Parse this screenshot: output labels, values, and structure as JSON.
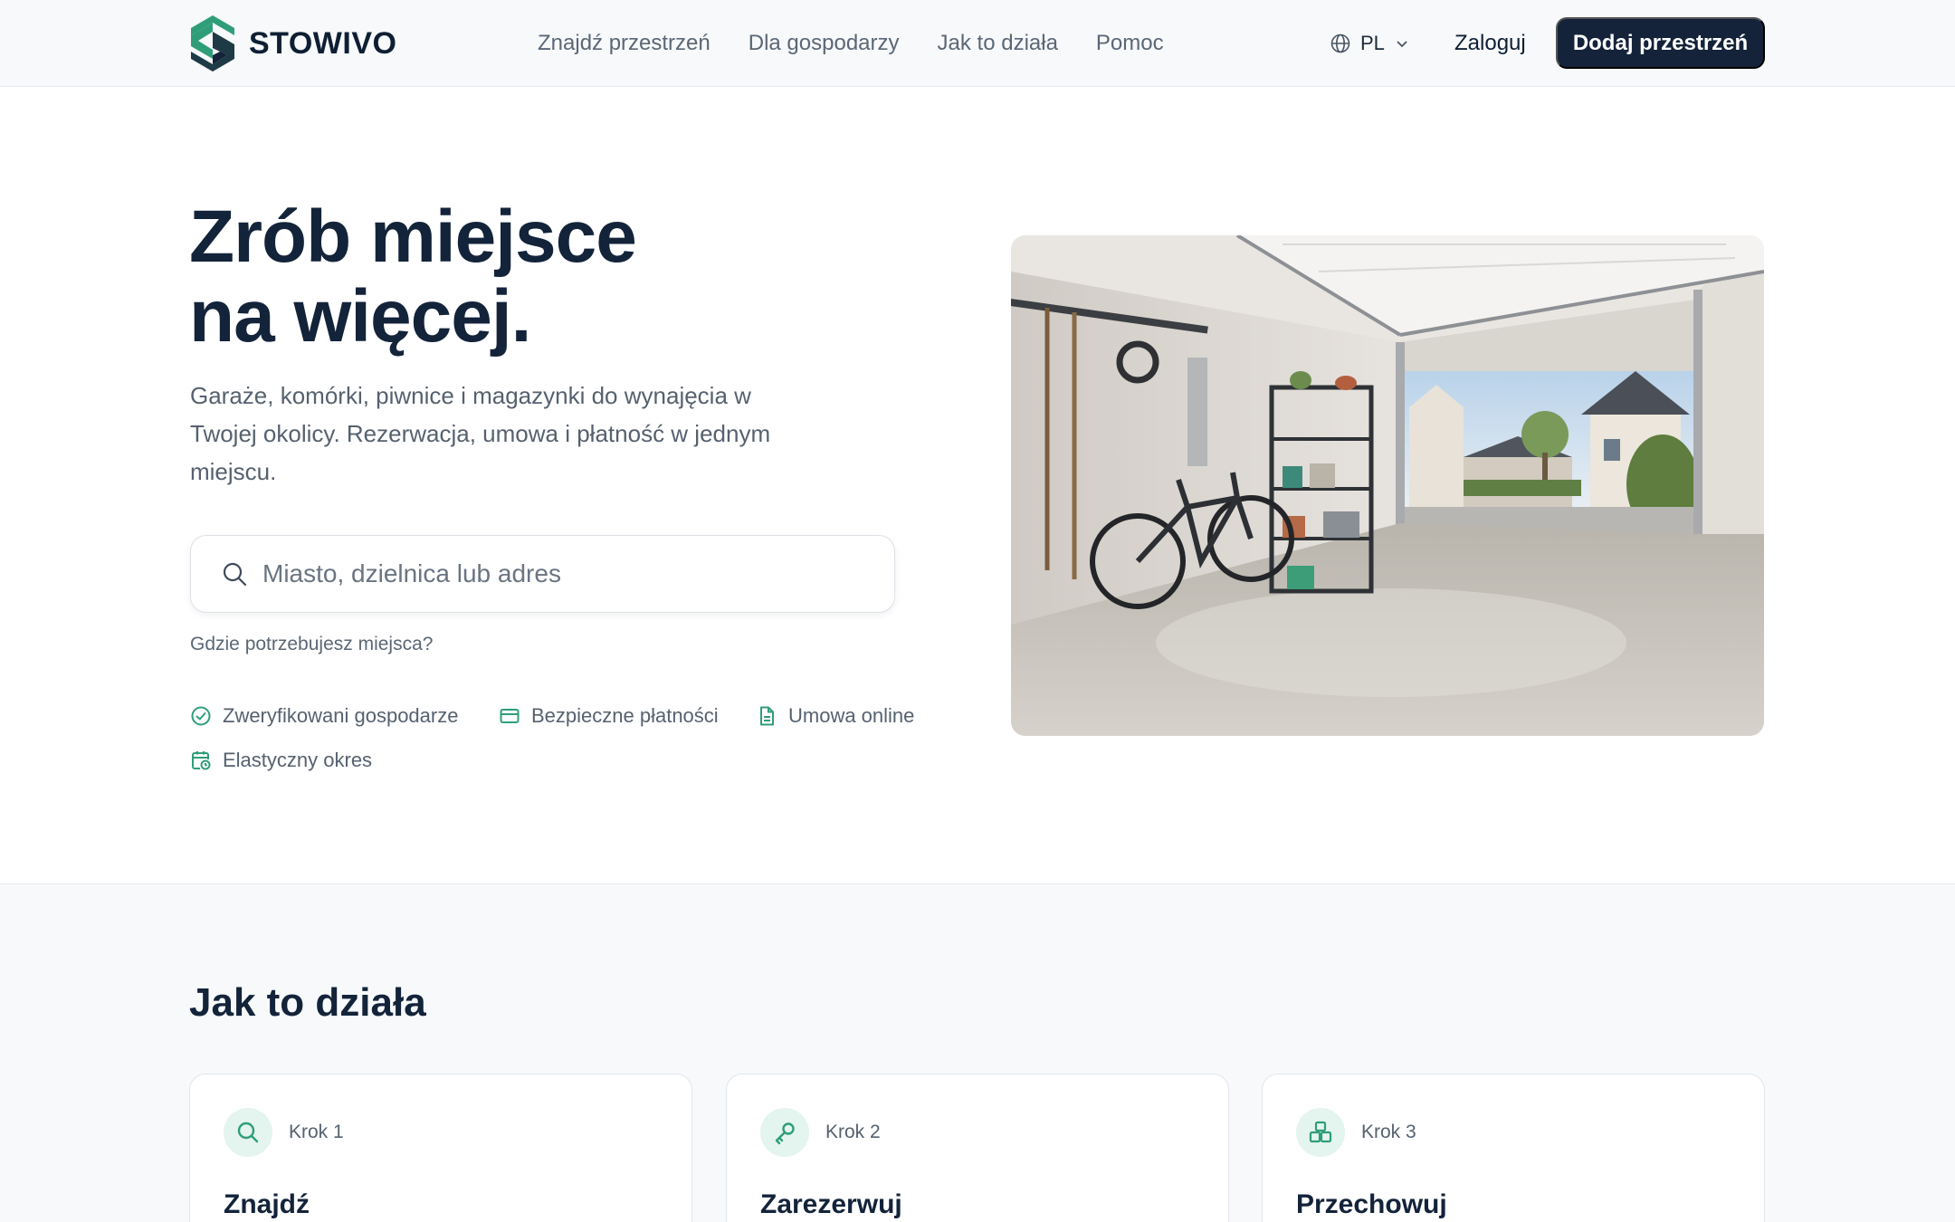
{
  "brand": {
    "name": "STOWIVO"
  },
  "nav": {
    "items": [
      {
        "label": "Znajdź przestrzeń"
      },
      {
        "label": "Dla gospodarzy"
      },
      {
        "label": "Jak to działa"
      },
      {
        "label": "Pomoc"
      }
    ]
  },
  "header": {
    "language": "PL",
    "login_label": "Zaloguj",
    "cta_label": "Dodaj przestrzeń"
  },
  "hero": {
    "title_line1": "Zrób miejsce",
    "title_line2": "na więcej.",
    "subtitle": "Garaże, komórki, piwnice i magazynki do wynajęcia w Twojej okolicy. Rezerwacja, umowa i płatność w jednym miejscu.",
    "search_placeholder": "Miasto, dzielnica lub adres",
    "search_hint": "Gdzie potrzebujesz miejsca?",
    "features": [
      {
        "label": "Zweryfikowani gospodarze",
        "icon": "check-circle-icon"
      },
      {
        "label": "Bezpieczne płatności",
        "icon": "credit-card-icon"
      },
      {
        "label": "Umowa online",
        "icon": "document-icon"
      },
      {
        "label": "Elastyczny okres",
        "icon": "calendar-clock-icon"
      }
    ]
  },
  "how_it_works": {
    "title": "Jak to działa",
    "steps": [
      {
        "step": "Krok 1",
        "title": "Znajdź",
        "icon": "search-icon"
      },
      {
        "step": "Krok 2",
        "title": "Zarezerwuj",
        "icon": "key-icon"
      },
      {
        "step": "Krok 3",
        "title": "Przechowuj",
        "icon": "boxes-icon"
      }
    ]
  },
  "colors": {
    "brand_green": "#2f9e78",
    "dark_navy": "#14233a",
    "muted_text": "#56616f",
    "icon_bg": "#e4f4ee"
  }
}
